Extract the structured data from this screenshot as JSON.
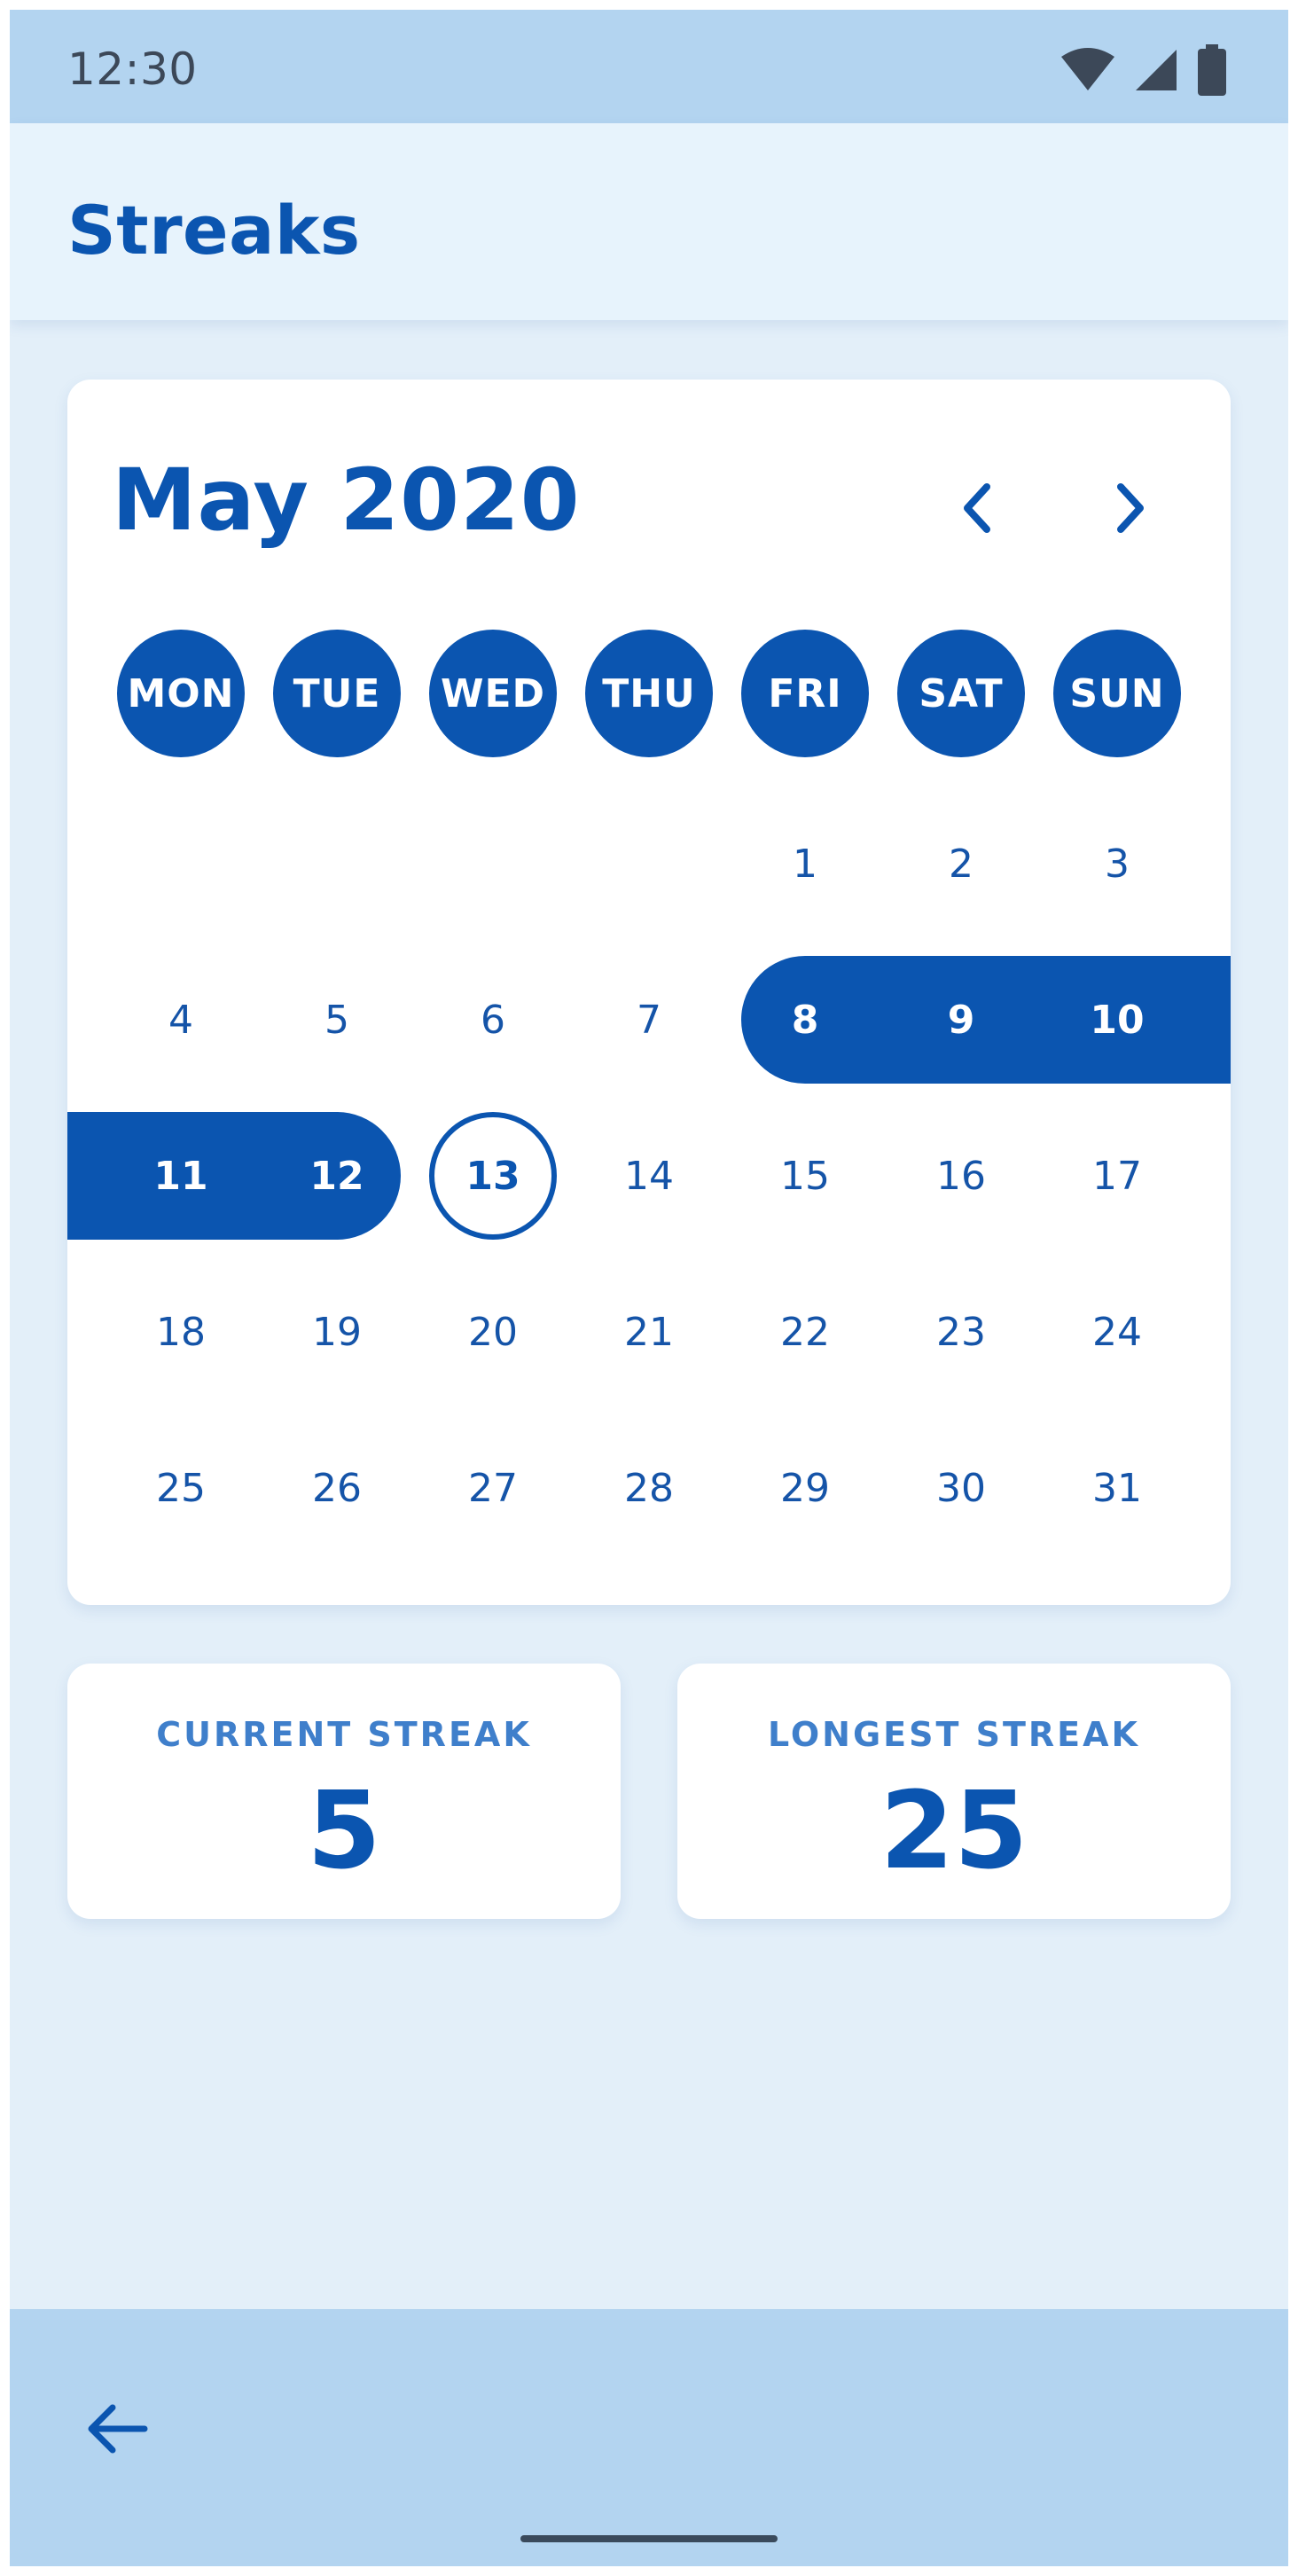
{
  "status_bar": {
    "time": "12:30",
    "icons": [
      "wifi-icon",
      "signal-icon",
      "battery-icon"
    ]
  },
  "app_bar": {
    "title": "Streaks"
  },
  "calendar": {
    "month_label": "May 2020",
    "prev_icon": "chevron-left-icon",
    "next_icon": "chevron-right-icon",
    "weekdays": [
      "MON",
      "TUE",
      "WED",
      "THU",
      "FRI",
      "SAT",
      "SUN"
    ],
    "first_weekday_index": 4,
    "days_in_month": 31,
    "streak_days": [
      8,
      9,
      10,
      11,
      12
    ],
    "today": 13
  },
  "stats": {
    "current_label": "CURRENT STREAK",
    "current_value": "5",
    "longest_label": "LONGEST STREAK",
    "longest_value": "25"
  },
  "bottom_bar": {
    "back_icon": "arrow-back-icon"
  },
  "colors": {
    "primary": "#0b55b0",
    "status_bar": "#b3d4f0",
    "app_bar": "#e7f3fc",
    "background": "#e3eff9",
    "card": "#ffffff"
  }
}
